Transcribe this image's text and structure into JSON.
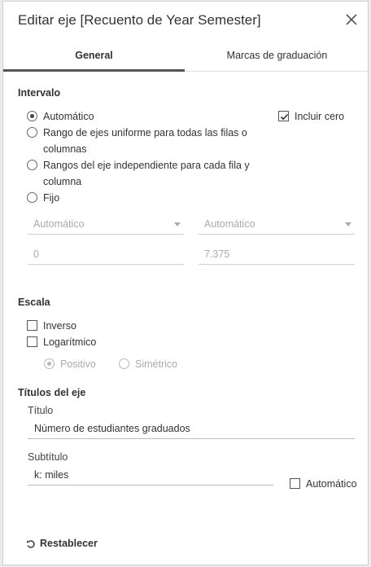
{
  "dialog": {
    "title": "Editar eje [Recuento de Year Semester]",
    "close_icon": "close-icon"
  },
  "tabs": [
    {
      "label": "General",
      "active": true
    },
    {
      "label": "Marcas de graduación",
      "active": false
    }
  ],
  "range": {
    "heading": "Intervalo",
    "options": [
      {
        "label": "Automático",
        "selected": true
      },
      {
        "label": "Rango de ejes uniforme para todas las filas o",
        "label2": "columnas",
        "selected": false
      },
      {
        "label": "Rangos del eje independiente para cada fila y",
        "label2": "columna",
        "selected": false
      },
      {
        "label": "Fijo",
        "selected": false
      }
    ],
    "include_zero": {
      "label": "Incluir cero",
      "checked": true
    },
    "start_select": "Automático",
    "end_select": "Automático",
    "start_value": "0",
    "end_value": "7.375"
  },
  "scale": {
    "heading": "Escala",
    "reversed": {
      "label": "Inverso",
      "checked": false
    },
    "logarithmic": {
      "label": "Logarítmico",
      "checked": false
    },
    "positive": {
      "label": "Positivo",
      "selected": true
    },
    "symmetric": {
      "label": "Simétrico",
      "selected": false
    }
  },
  "axis_titles": {
    "heading": "Títulos del eje",
    "title_label": "Título",
    "title_value": "Número de estudiantes graduados",
    "subtitle_label": "Subtítulo",
    "subtitle_value": "k: miles",
    "auto": {
      "label": "Automático",
      "checked": false
    }
  },
  "footer": {
    "reset_label": "Restablecer",
    "reset_icon": "undo-icon"
  },
  "colors": {
    "tab_underline": "#555555",
    "disabled_text": "#aaaaaa"
  }
}
